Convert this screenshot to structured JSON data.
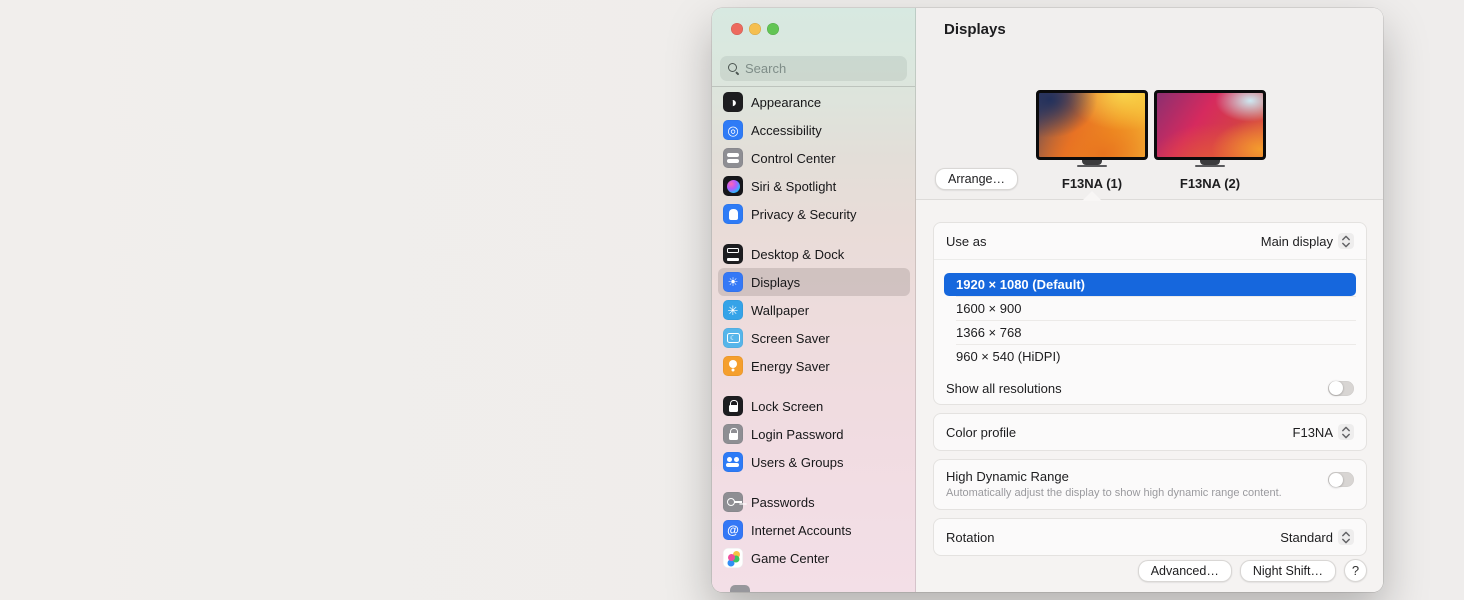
{
  "colors": {
    "traffic_red": "#ed6a5e",
    "traffic_yellow": "#f5bf4f",
    "traffic_green": "#62c554",
    "selection_blue": "#1667dd",
    "sidebar_selected_icon_blue": "#3478f6"
  },
  "sidebar": {
    "search_placeholder": "Search",
    "groups": [
      {
        "items": [
          {
            "label": "Appearance",
            "icon": "appearance-icon"
          },
          {
            "label": "Accessibility",
            "icon": "accessibility-icon"
          },
          {
            "label": "Control Center",
            "icon": "control-center-icon"
          },
          {
            "label": "Siri & Spotlight",
            "icon": "siri-icon"
          },
          {
            "label": "Privacy & Security",
            "icon": "privacy-security-icon"
          }
        ]
      },
      {
        "items": [
          {
            "label": "Desktop & Dock",
            "icon": "desktop-dock-icon"
          },
          {
            "label": "Displays",
            "icon": "displays-icon",
            "selected": true
          },
          {
            "label": "Wallpaper",
            "icon": "wallpaper-icon"
          },
          {
            "label": "Screen Saver",
            "icon": "screen-saver-icon"
          },
          {
            "label": "Energy Saver",
            "icon": "energy-saver-icon"
          }
        ]
      },
      {
        "items": [
          {
            "label": "Lock Screen",
            "icon": "lock-screen-icon"
          },
          {
            "label": "Login Password",
            "icon": "login-password-icon"
          },
          {
            "label": "Users & Groups",
            "icon": "users-groups-icon"
          }
        ]
      },
      {
        "items": [
          {
            "label": "Passwords",
            "icon": "passwords-icon"
          },
          {
            "label": "Internet Accounts",
            "icon": "internet-accounts-icon"
          },
          {
            "label": "Game Center",
            "icon": "game-center-icon"
          }
        ]
      }
    ],
    "icon_glyphs": {
      "appearance": "◑",
      "accessibility": "◎",
      "displays_sun": "☀",
      "wallpaper_flower": "✳",
      "screensaver_moon": "☾",
      "internet_at": "@"
    }
  },
  "header": {
    "title": "Displays",
    "arrange_label": "Arrange…",
    "displays": [
      {
        "name": "F13NA (1)",
        "wallpaper": "ventura-orange"
      },
      {
        "name": "F13NA (2)",
        "wallpaper": "bigsur-pink"
      }
    ]
  },
  "settings": {
    "use_as": {
      "label": "Use as",
      "value": "Main display"
    },
    "resolutions": [
      {
        "label": "1920 × 1080 (Default)",
        "selected": true
      },
      {
        "label": "1600 × 900",
        "selected": false
      },
      {
        "label": "1366 × 768",
        "selected": false
      },
      {
        "label": "960 × 540 (HiDPI)",
        "selected": false
      }
    ],
    "show_all_resolutions": {
      "label": "Show all resolutions",
      "enabled": false
    },
    "color_profile": {
      "label": "Color profile",
      "value": "F13NA"
    },
    "hdr": {
      "label": "High Dynamic Range",
      "description": "Automatically adjust the display to show high dynamic range content.",
      "enabled": false
    },
    "rotation": {
      "label": "Rotation",
      "value": "Standard"
    },
    "footer": {
      "advanced_label": "Advanced…",
      "night_shift_label": "Night Shift…",
      "help_label": "?"
    }
  }
}
